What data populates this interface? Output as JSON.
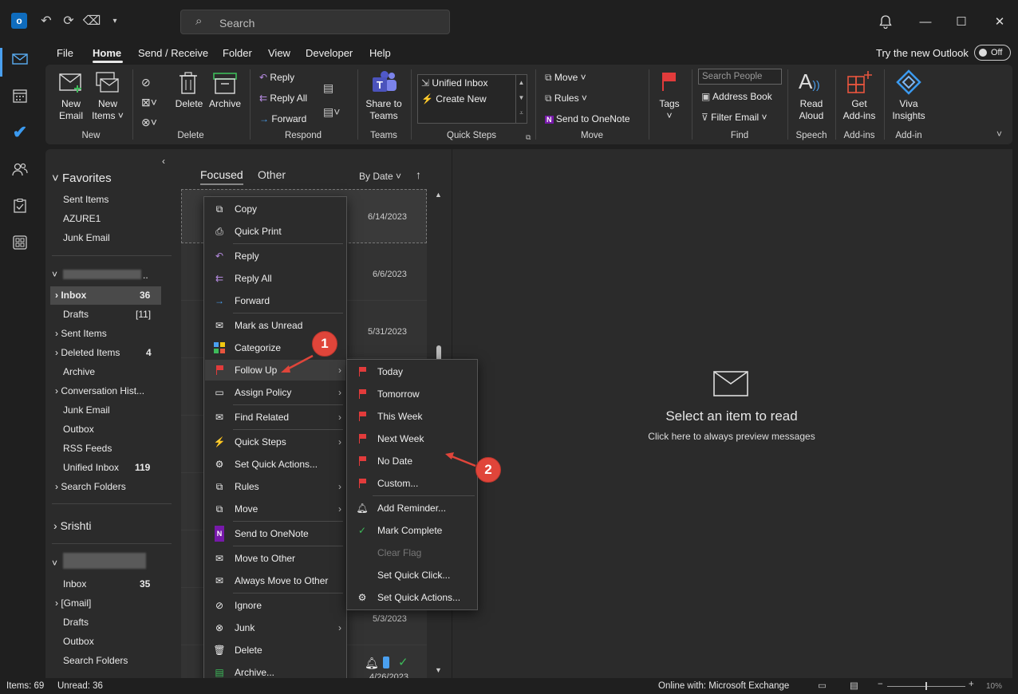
{
  "titlebar": {
    "search_placeholder": "Search"
  },
  "menu": [
    "File",
    "Home",
    "Send / Receive",
    "Folder",
    "View",
    "Developer",
    "Help"
  ],
  "try_new": "Try the new Outlook",
  "toggle": "Off",
  "ribbon": {
    "new_email": [
      "New",
      "Email"
    ],
    "new_items": [
      "New",
      "Items ˅"
    ],
    "grp_new": "New",
    "delete": "Delete",
    "archive": "Archive",
    "grp_delete": "Delete",
    "reply": "Reply",
    "reply_all": "Reply All",
    "forward": "Forward",
    "grp_respond": "Respond",
    "share_teams": [
      "Share to",
      "Teams"
    ],
    "grp_teams": "Teams",
    "qs_unified": "Unified Inbox",
    "qs_create": "Create New",
    "grp_qs": "Quick Steps",
    "move": "Move ˅",
    "rules": "Rules ˅",
    "send_onenote": "Send to OneNote",
    "grp_move": "Move",
    "tags": "Tags",
    "search_people": "Search People",
    "address_book": "Address Book",
    "filter_email": "Filter Email ˅",
    "grp_find": "Find",
    "read_aloud": [
      "Read",
      "Aloud"
    ],
    "grp_speech": "Speech",
    "get_addins": [
      "Get",
      "Add-ins"
    ],
    "grp_addins": "Add-ins",
    "viva": [
      "Viva",
      "Insights"
    ],
    "grp_addin2": "Add-in"
  },
  "folders": {
    "favorites": "Favorites",
    "fav_items": [
      "Sent Items",
      "AZURE1",
      "Junk Email"
    ],
    "acct1_dot": "..",
    "inbox": "Inbox",
    "inbox_count": "36",
    "drafts": "Drafts",
    "drafts_count": "[11]",
    "sent": "Sent Items",
    "deleted": "Deleted Items",
    "deleted_count": "4",
    "archive": "Archive",
    "conv": "Conversation Hist...",
    "junk": "Junk Email",
    "outbox": "Outbox",
    "rss": "RSS Feeds",
    "unified": "Unified Inbox",
    "unified_count": "119",
    "searchf": "Search Folders",
    "srishti": "Srishti",
    "inbox2": "Inbox",
    "inbox2_count": "35",
    "gmail": "[Gmail]",
    "drafts2": "Drafts",
    "outbox2": "Outbox",
    "searchf2": "Search Folders"
  },
  "list": {
    "focused": "Focused",
    "other": "Other",
    "sort": "By Date ˅",
    "dates": [
      "6/14/2023",
      "6/6/2023",
      "5/31/2023",
      "5/3/2023",
      "4/26/2023"
    ]
  },
  "reading": {
    "title": "Select an item to read",
    "sub": "Click here to always preview messages"
  },
  "context_menu": [
    "Copy",
    "Quick Print",
    "Reply",
    "Reply All",
    "Forward",
    "Mark as Unread",
    "Categorize",
    "Follow Up",
    "Assign Policy",
    "Find Related",
    "Quick Steps",
    "Set Quick Actions...",
    "Rules",
    "Move",
    "Send to OneNote",
    "Move to Other",
    "Always Move to Other",
    "Ignore",
    "Junk",
    "Delete",
    "Archive..."
  ],
  "submenu": [
    "Today",
    "Tomorrow",
    "This Week",
    "Next Week",
    "No Date",
    "Custom...",
    "Add Reminder...",
    "Mark Complete",
    "Clear Flag",
    "Set Quick Click...",
    "Set Quick Actions..."
  ],
  "badges": [
    "1",
    "2"
  ],
  "status": {
    "items": "Items: 69",
    "unread": "Unread: 36",
    "online": "Online with: Microsoft Exchange",
    "zoom": "10%"
  }
}
